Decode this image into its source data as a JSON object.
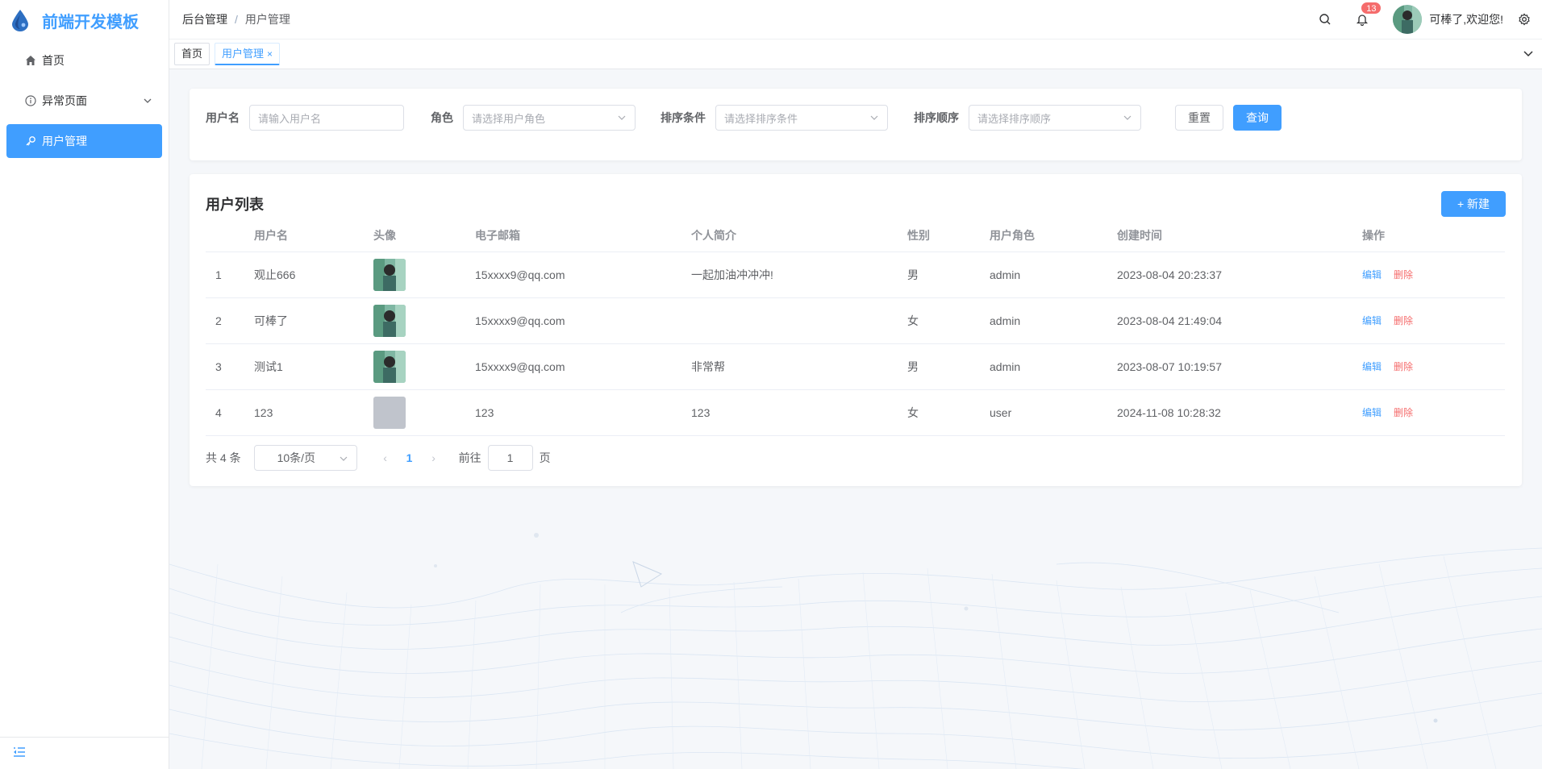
{
  "sidebar": {
    "logo_text": "前端开发模板",
    "items": [
      {
        "label": "首页",
        "icon": "home-icon"
      },
      {
        "label": "异常页面",
        "icon": "info-circle-icon"
      },
      {
        "label": "用户管理",
        "icon": "key-icon"
      }
    ],
    "collapse_icon": "collapse-menu-icon"
  },
  "header": {
    "breadcrumb": [
      "后台管理",
      "用户管理"
    ],
    "breadcrumb_sep": "/",
    "notification_count": "13",
    "welcome": "可棒了,欢迎您!"
  },
  "tabs": [
    {
      "label": "首页"
    },
    {
      "label": "用户管理",
      "close": "×"
    }
  ],
  "search": {
    "username_label": "用户名",
    "username_placeholder": "请输入用户名",
    "role_label": "角色",
    "role_placeholder": "请选择用户角色",
    "sort_label": "排序条件",
    "sort_placeholder": "请选择排序条件",
    "order_label": "排序顺序",
    "order_placeholder": "请选择排序顺序",
    "reset_label": "重置",
    "query_label": "查询"
  },
  "list": {
    "title": "用户列表",
    "new_label": "+ 新建",
    "columns": [
      "",
      "用户名",
      "头像",
      "电子邮箱",
      "个人简介",
      "性别",
      "用户角色",
      "创建时间",
      "操作"
    ],
    "rows": [
      {
        "idx": "1",
        "username": "观止666",
        "email": "15xxxx9@qq.com",
        "bio": "一起加油冲冲冲!",
        "gender": "男",
        "role": "admin",
        "created": "2023-08-04 20:23:37",
        "avatar": "photo"
      },
      {
        "idx": "2",
        "username": "可棒了",
        "email": "15xxxx9@qq.com",
        "bio": "",
        "gender": "女",
        "role": "admin",
        "created": "2023-08-04 21:49:04",
        "avatar": "photo"
      },
      {
        "idx": "3",
        "username": "测试1",
        "email": "15xxxx9@qq.com",
        "bio": "非常帮",
        "gender": "男",
        "role": "admin",
        "created": "2023-08-07 10:19:57",
        "avatar": "photo"
      },
      {
        "idx": "4",
        "username": "123",
        "email": "123",
        "bio": "123",
        "gender": "女",
        "role": "user",
        "created": "2024-11-08 10:28:32",
        "avatar": "placeholder"
      }
    ],
    "edit_label": "编辑",
    "delete_label": "删除"
  },
  "pager": {
    "total": "共 4 条",
    "page_size": "10条/页",
    "current": "1",
    "goto_label": "前往",
    "goto_value": "1",
    "page_suffix": "页"
  },
  "colors": {
    "primary": "#409eff",
    "danger": "#f56c6c"
  }
}
